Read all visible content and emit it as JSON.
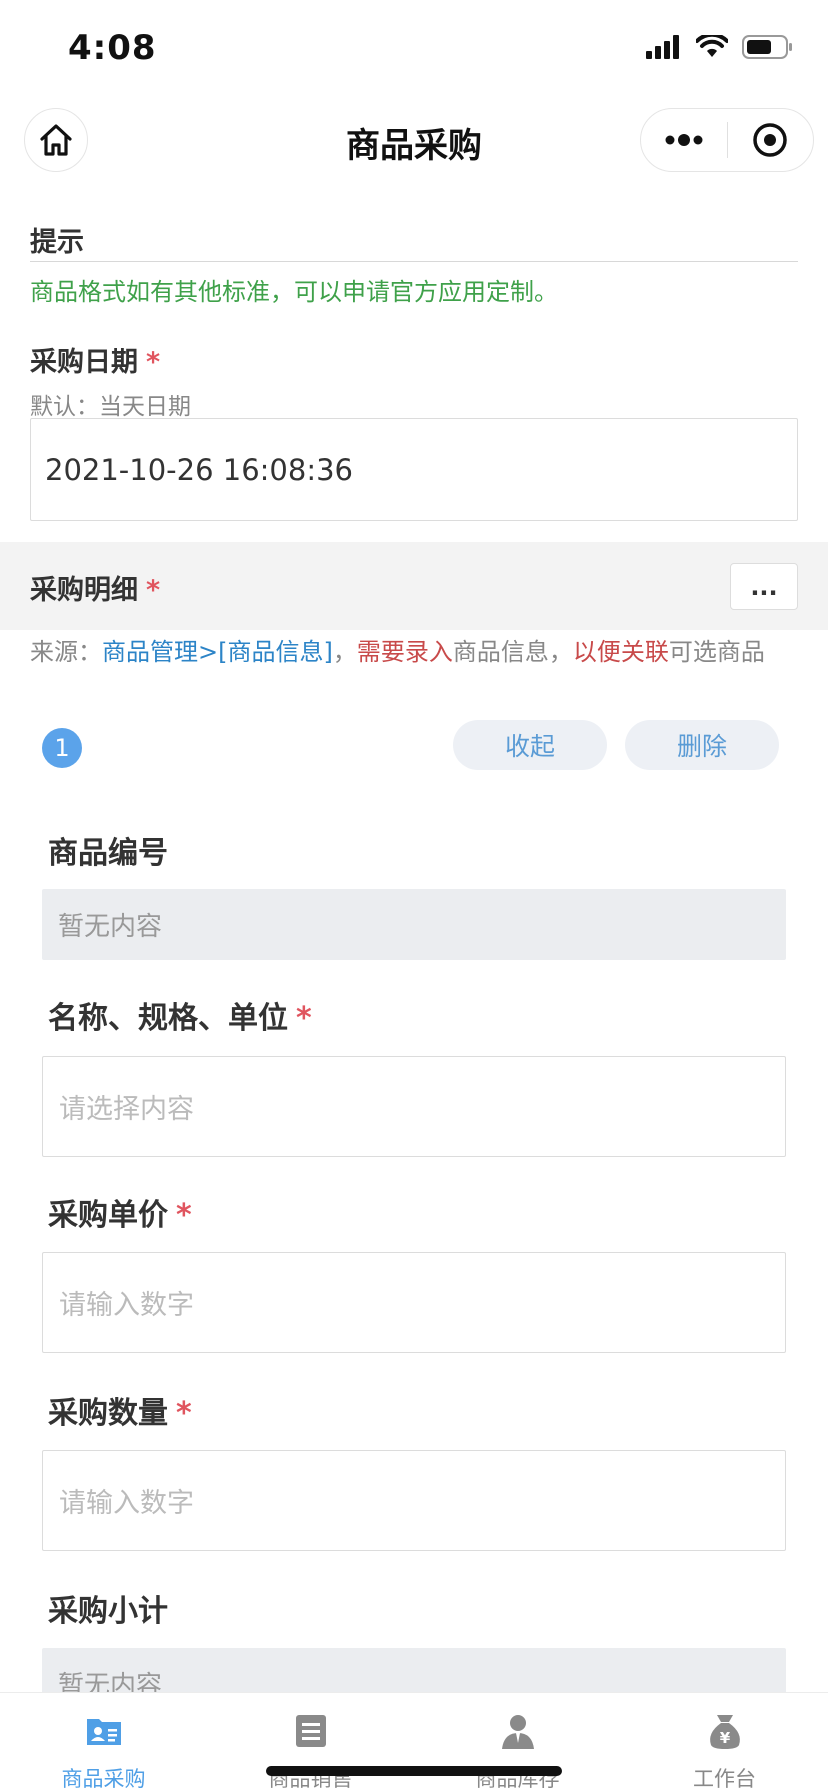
{
  "status_bar": {
    "time": "4:08"
  },
  "nav": {
    "title": "商品采购"
  },
  "hint": {
    "label": "提示",
    "text": "商品格式如有其他标准，可以申请官方应用定制。"
  },
  "purchase_date": {
    "label": "采购日期",
    "required_mark": "*",
    "sub_hint": "默认：当天日期",
    "value": "2021-10-26 16:08:36"
  },
  "purchase_detail": {
    "label": "采购明细",
    "required_mark": "*",
    "more_label": "...",
    "source": {
      "prefix": "来源：",
      "link": "商品管理>[商品信息]",
      "sep1": "，",
      "warn1": "需要录入",
      "mid": "商品信息，",
      "warn2": "以便关联",
      "suffix": "可选商品"
    }
  },
  "item": {
    "index": "1",
    "collapse_label": "收起",
    "delete_label": "删除",
    "fields": {
      "code": {
        "label": "商品编号",
        "value": "暂无内容"
      },
      "name": {
        "label": "名称、规格、单位",
        "required_mark": "*",
        "placeholder": "请选择内容"
      },
      "unit_price": {
        "label": "采购单价",
        "required_mark": "*",
        "placeholder": "请输入数字"
      },
      "quantity": {
        "label": "采购数量",
        "required_mark": "*",
        "placeholder": "请输入数字"
      },
      "subtotal": {
        "label": "采购小计",
        "value": "暂无内容"
      }
    }
  },
  "tabs": [
    {
      "label": "商品采购",
      "icon": "contact-card-icon",
      "active": true
    },
    {
      "label": "商品销售",
      "icon": "document-list-icon",
      "active": false
    },
    {
      "label": "商品库存",
      "icon": "person-icon",
      "active": false
    },
    {
      "label": "工作台",
      "icon": "money-bag-icon",
      "active": false
    }
  ],
  "colors": {
    "accent_blue": "#4f9fe6",
    "hint_green": "#3fa14a",
    "required_red": "#e0555f",
    "link_blue": "#2c84c7",
    "warn_red": "#c84a4a"
  }
}
